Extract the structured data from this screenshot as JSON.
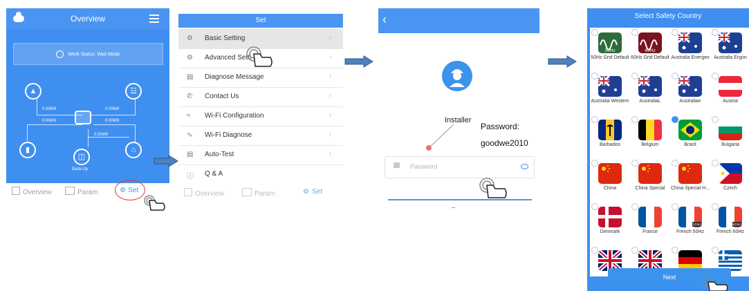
{
  "colors": {
    "accent": "#3b93ee",
    "header_blue": "#4a95f2",
    "highlight_red": "#e53935"
  },
  "screen1": {
    "title": "Overview",
    "status_text": "Work Status: Wait Mode",
    "kw_labels": [
      "0.00kW",
      "0.00kW",
      "0.00kW",
      "0.00kW",
      "0.00kW"
    ],
    "backup_label": "Back-Up",
    "nav": {
      "overview": "Overview",
      "param": "Param",
      "set": "Set"
    }
  },
  "screen2": {
    "title": "Set",
    "items": [
      {
        "label": "Basic Setting",
        "icon": "gear-icon"
      },
      {
        "label": "Advanced Setti",
        "icon": "advanced-gear-icon"
      },
      {
        "label": "Diagnose Message",
        "icon": "message-icon"
      },
      {
        "label": "Contact Us",
        "icon": "phone-icon"
      },
      {
        "label": "Wi-Fi Configuration",
        "icon": "wifi-icon"
      },
      {
        "label": "Wi-Fi Diagnose",
        "icon": "wifi-diagnose-icon"
      },
      {
        "label": "Auto-Test",
        "icon": "checklist-icon"
      },
      {
        "label": "Q & A",
        "icon": "question-icon"
      }
    ],
    "nav": {
      "overview": "Overview",
      "param": "Param",
      "set": "Set"
    }
  },
  "screen3": {
    "installer_label": "Installer",
    "password_placeholder": "Password",
    "annotation_line1": "Password:",
    "annotation_line2": "goodwe2010"
  },
  "screen4": {
    "title": "Select Safety Country",
    "next_label": "Next",
    "countries": [
      {
        "name": "50Hz Grid Default",
        "tag": "50Hz",
        "flag": "wave-50hz",
        "checked": false
      },
      {
        "name": "60Hz Grid Default",
        "tag": "60Hz",
        "flag": "wave-60hz",
        "checked": false
      },
      {
        "name": "Australia Energex",
        "tag": "",
        "flag": "australia",
        "checked": false
      },
      {
        "name": "Australia Ergon",
        "tag": "",
        "flag": "australia",
        "checked": false
      },
      {
        "name": "Australia Western",
        "tag": "",
        "flag": "australia",
        "checked": false
      },
      {
        "name": "AustraliaL",
        "tag": "",
        "flag": "australia",
        "checked": false
      },
      {
        "name": "Australian",
        "tag": "",
        "flag": "australia",
        "checked": false
      },
      {
        "name": "Austria",
        "tag": "",
        "flag": "austria",
        "checked": false
      },
      {
        "name": "Barbados",
        "tag": "",
        "flag": "barbados",
        "checked": false
      },
      {
        "name": "Belgium",
        "tag": "",
        "flag": "belgium",
        "checked": false
      },
      {
        "name": "Brazil",
        "tag": "",
        "flag": "brazil",
        "checked": true
      },
      {
        "name": "Bulgaria",
        "tag": "",
        "flag": "bulgaria",
        "checked": false
      },
      {
        "name": "China",
        "tag": "",
        "flag": "china",
        "checked": false
      },
      {
        "name": "China Special",
        "tag": "",
        "flag": "china",
        "checked": false
      },
      {
        "name": "China Special H...",
        "tag": "",
        "flag": "china",
        "checked": false
      },
      {
        "name": "Czech",
        "tag": "",
        "flag": "philippines",
        "checked": false
      },
      {
        "name": "Denmark",
        "tag": "",
        "flag": "denmark",
        "checked": false
      },
      {
        "name": "France",
        "tag": "",
        "flag": "france",
        "checked": false
      },
      {
        "name": "French 50Hz",
        "tag": "50Hz",
        "flag": "france",
        "checked": false
      },
      {
        "name": "French 60Hz",
        "tag": "60Hz",
        "flag": "france",
        "checked": false
      },
      {
        "name": "",
        "tag": "",
        "flag": "uk",
        "checked": false
      },
      {
        "name": "",
        "tag": "",
        "flag": "uk",
        "checked": false
      },
      {
        "name": "",
        "tag": "",
        "flag": "germany",
        "checked": false
      },
      {
        "name": "",
        "tag": "",
        "flag": "greece",
        "checked": false
      }
    ]
  }
}
